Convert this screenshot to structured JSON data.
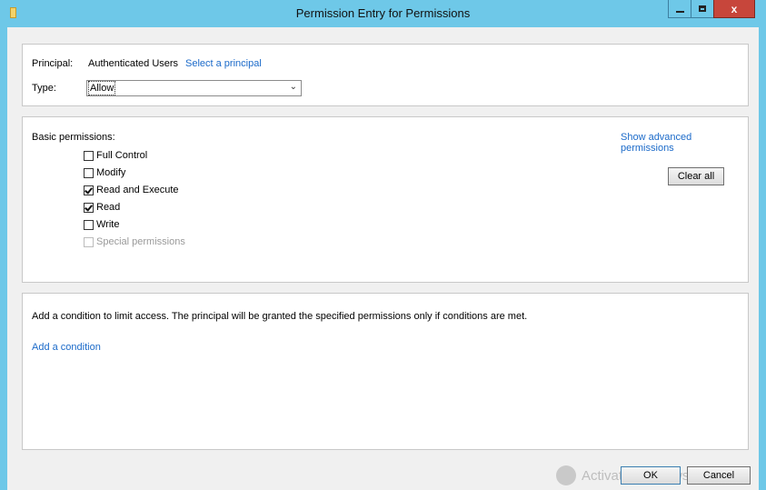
{
  "window": {
    "title": "Permission Entry for Permissions",
    "controls": {
      "minimize": "minimize",
      "maximize": "maximize",
      "close": "x"
    }
  },
  "principal": {
    "label": "Principal:",
    "value": "Authenticated Users",
    "select_link": "Select a principal"
  },
  "type": {
    "label": "Type:",
    "selected": "Allow",
    "options_visible": [
      "Allow"
    ]
  },
  "permissions": {
    "heading": "Basic permissions:",
    "advanced_link": "Show advanced permissions",
    "items": [
      {
        "label": "Full Control",
        "checked": false,
        "disabled": false
      },
      {
        "label": "Modify",
        "checked": false,
        "disabled": false
      },
      {
        "label": "Read and Execute",
        "checked": true,
        "disabled": false
      },
      {
        "label": "Read",
        "checked": true,
        "disabled": false
      },
      {
        "label": "Write",
        "checked": false,
        "disabled": false
      },
      {
        "label": "Special permissions",
        "checked": false,
        "disabled": true
      }
    ],
    "clear_all": "Clear all"
  },
  "condition": {
    "description": "Add a condition to limit access. The principal will be granted the specified permissions only if conditions are met.",
    "add_link": "Add a condition"
  },
  "footer": {
    "ok": "OK",
    "cancel": "Cancel",
    "watermark": "Activate Windows"
  },
  "colors": {
    "titlebar": "#6ec8e8",
    "link": "#1b6ac9",
    "close_button": "#c7463b",
    "dialog_background": "#f0f0f0"
  }
}
